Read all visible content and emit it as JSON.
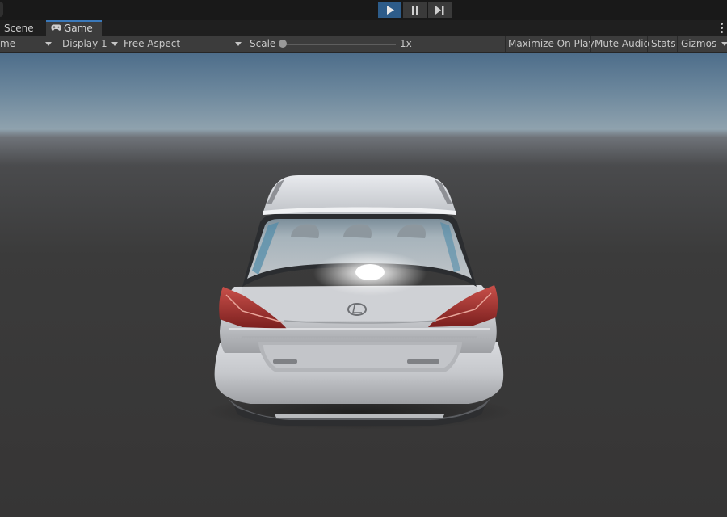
{
  "playbar": {
    "play_icon": "play-icon",
    "pause_icon": "pause-icon",
    "step_icon": "step-icon"
  },
  "tabs": [
    {
      "label": "Scene"
    },
    {
      "label": "Game",
      "icon": "gamepad-icon"
    }
  ],
  "toolbar": {
    "game_dropdown": "me",
    "display_dropdown": "Display 1",
    "aspect_dropdown": "Free Aspect",
    "scale_label": "Scale",
    "scale_value": "1x",
    "scale_level": 0,
    "maximize_on_play": "Maximize On Play",
    "mute_audio": "Mute Audio",
    "stats": "Stats",
    "gizmos": "Gizmos"
  },
  "colors": {
    "accent": "#3a79bb",
    "play_active": "#2d5c8a",
    "panel": "#3c3c3c"
  }
}
